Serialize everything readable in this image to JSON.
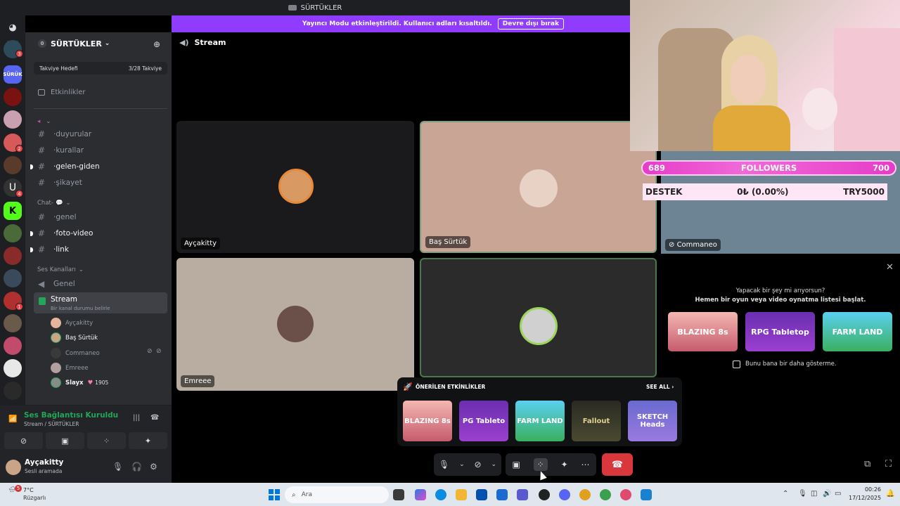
{
  "window": {
    "title": "SÜRTÜKLER"
  },
  "banner": {
    "text": "Yayıncı Modu etkinleştirildi. Kullanıcı adları kısaltıldı.",
    "button": "Devre dışı bırak"
  },
  "rail": {
    "badges": [
      "3",
      "2",
      "4",
      "1"
    ]
  },
  "server": {
    "name": "SÜRTÜKLER",
    "count": "0",
    "boost_label": "Takviye Hedefi",
    "boost_value": "3/28 Takviye",
    "events_label": "Etkinlikler"
  },
  "channels": {
    "cat1": "",
    "text": [
      {
        "name": "duyurular"
      },
      {
        "name": "kurallar"
      },
      {
        "name": "gelen-giden"
      },
      {
        "name": "şikayet"
      }
    ],
    "cat2": "Chat-",
    "text2": [
      {
        "name": "genel"
      },
      {
        "name": "foto-video"
      },
      {
        "name": "link"
      }
    ],
    "voice_cat": "Ses Kanalları",
    "voice": [
      {
        "name": "Genel"
      }
    ],
    "stream": {
      "name": "Stream",
      "status": "Bir kanal durumu belirle"
    },
    "voice_users": [
      {
        "name": "Ayçakitty"
      },
      {
        "name": "Baş Sürtük"
      },
      {
        "name": "Commaneo"
      },
      {
        "name": "Emreee"
      },
      {
        "name": "Slayx"
      }
    ],
    "slayx_count": "1905"
  },
  "voice_panel": {
    "title": "Ses Bağlantısı Kuruldu",
    "subtitle": "Stream / SÜRTÜKLER"
  },
  "user_panel": {
    "name": "Ayçakitty",
    "status": "Sesli aramada"
  },
  "stage": {
    "title": "Stream",
    "tiles": [
      {
        "label": "Ayçakitty"
      },
      {
        "label": "Baş Sürtük"
      },
      {
        "label": "Commaneo"
      },
      {
        "label": "Emreee"
      }
    ]
  },
  "overlay": {
    "followers_current": "689",
    "followers_label": "FOLLOWERS",
    "followers_goal": "700",
    "donate_label": "DESTEK",
    "donate_value": "0₺ (0.00%)",
    "donate_goal": "TRY5000"
  },
  "activity_prompt": {
    "line1": "Yapacak bir şey mi arıyorsun?",
    "line2": "Hemen bir oyun veya video oynatma listesi başlat.",
    "cards": [
      "BLAZING 8s",
      "RPG Tabletop",
      "FARM LAND"
    ],
    "checkbox_label": "Bunu bana bir daha gösterme."
  },
  "suggested": {
    "title": "ÖNERİLEN ETKİNLİKLER",
    "see_all": "SEE ALL",
    "games": [
      "BLAZING 8s",
      "PG Tableto",
      "FARM LAND",
      "Fallout",
      "SKETCH Heads"
    ]
  },
  "taskbar": {
    "weather_badge": "5",
    "temp": "7°C",
    "city": "Rüzgarlı",
    "search_placeholder": "Ara",
    "time": "00:26",
    "date": "17/12/2025"
  },
  "colors": {
    "accent": "#8f3cff",
    "online": "#23a55a",
    "danger": "#da373c",
    "pink_bar": "#e63cc9"
  }
}
